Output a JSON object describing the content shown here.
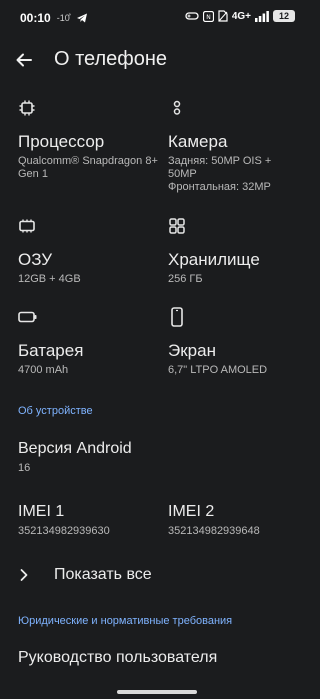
{
  "status_bar": {
    "time": "00:10",
    "temp": "-10̊",
    "network": "4G+",
    "battery": "12"
  },
  "header": {
    "title": "О телефоне"
  },
  "specs": {
    "processor": {
      "label": "Процессор",
      "value": "Qualcomm® Snapdragon 8+ Gen 1",
      "icon": "chip-icon"
    },
    "camera": {
      "label": "Камера",
      "value_line1": "Задняя: 50MP OIS +",
      "value_line2": "50MP",
      "value_line3": "Фронтальная: 32MP",
      "icon": "camera-icon"
    },
    "ram": {
      "label": "ОЗУ",
      "value": "12GB + 4GB",
      "icon": "memory-icon"
    },
    "storage": {
      "label": "Хранилище",
      "value": "256 ГБ",
      "icon": "grid-icon"
    },
    "battery": {
      "label": "Батарея",
      "value": "4700 mAh",
      "icon": "battery-icon"
    },
    "display": {
      "label": "Экран",
      "value": "6,7\" LTPO AMOLED",
      "icon": "phone-icon"
    }
  },
  "about_section": {
    "header": "Об устройстве",
    "android": {
      "label": "Версия Android",
      "value": "16"
    },
    "imei1": {
      "label": "IMEI 1",
      "value": "352134982939630"
    },
    "imei2": {
      "label": "IMEI 2",
      "value": "352134982939648"
    },
    "show_all": "Показать все"
  },
  "legal_section": {
    "header": "Юридические и нормативные требования",
    "manual": "Руководство пользователя"
  },
  "colors": {
    "background": "#1b1c1e",
    "accent": "#7fb3ff",
    "text": "#ececec",
    "secondary": "#b9b9b9"
  }
}
